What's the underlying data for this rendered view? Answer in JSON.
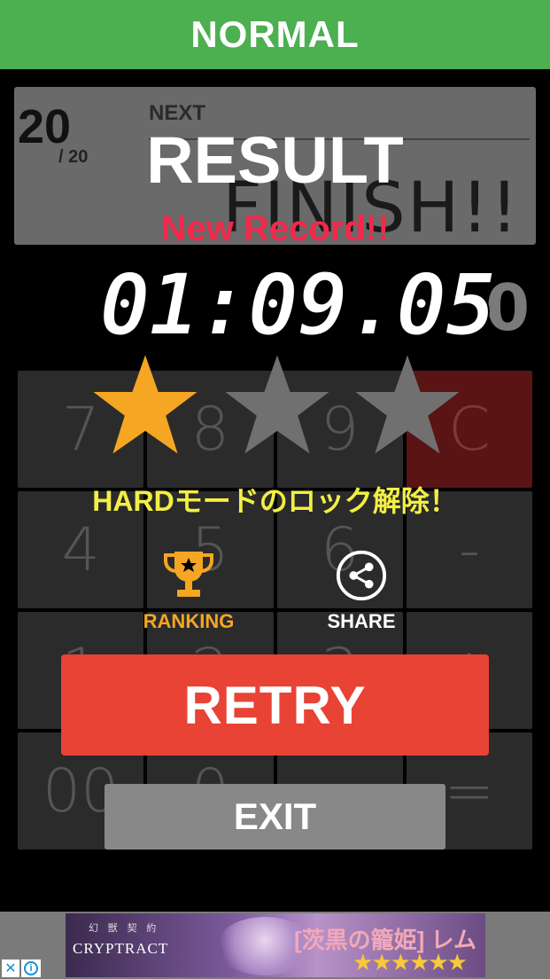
{
  "header": {
    "title": "NORMAL",
    "color": "#4caf50"
  },
  "status": {
    "count_current": "20",
    "count_total": "/ 20",
    "next_label": "NEXT",
    "finish_text": "FINISH!!"
  },
  "side_zero": "0",
  "keypad": [
    "7",
    "8",
    "9",
    "C",
    "4",
    "5",
    "6",
    "-",
    "1",
    "2",
    "3",
    "+",
    "00",
    "0",
    ".",
    "="
  ],
  "result": {
    "title": "RESULT",
    "new_record": "New Record!!",
    "time": "01:09.05",
    "stars_earned": 1,
    "stars_total": 3,
    "unlock_message": "HARDモードのロック解除！"
  },
  "actions": {
    "ranking_label": "RANKING",
    "share_label": "SHARE",
    "retry_label": "RETRY",
    "exit_label": "EXIT"
  },
  "ad": {
    "brand": "CRYPTRACT",
    "brand_sub": "幻 獣 契 約",
    "headline": "[茨黒の籠姫] レム",
    "rating": "★★★★★★"
  },
  "colors": {
    "star_gold": "#f5a623",
    "star_gray": "#707070",
    "retry": "#e84335",
    "record": "#f2294a",
    "unlock": "#f2ef45"
  }
}
